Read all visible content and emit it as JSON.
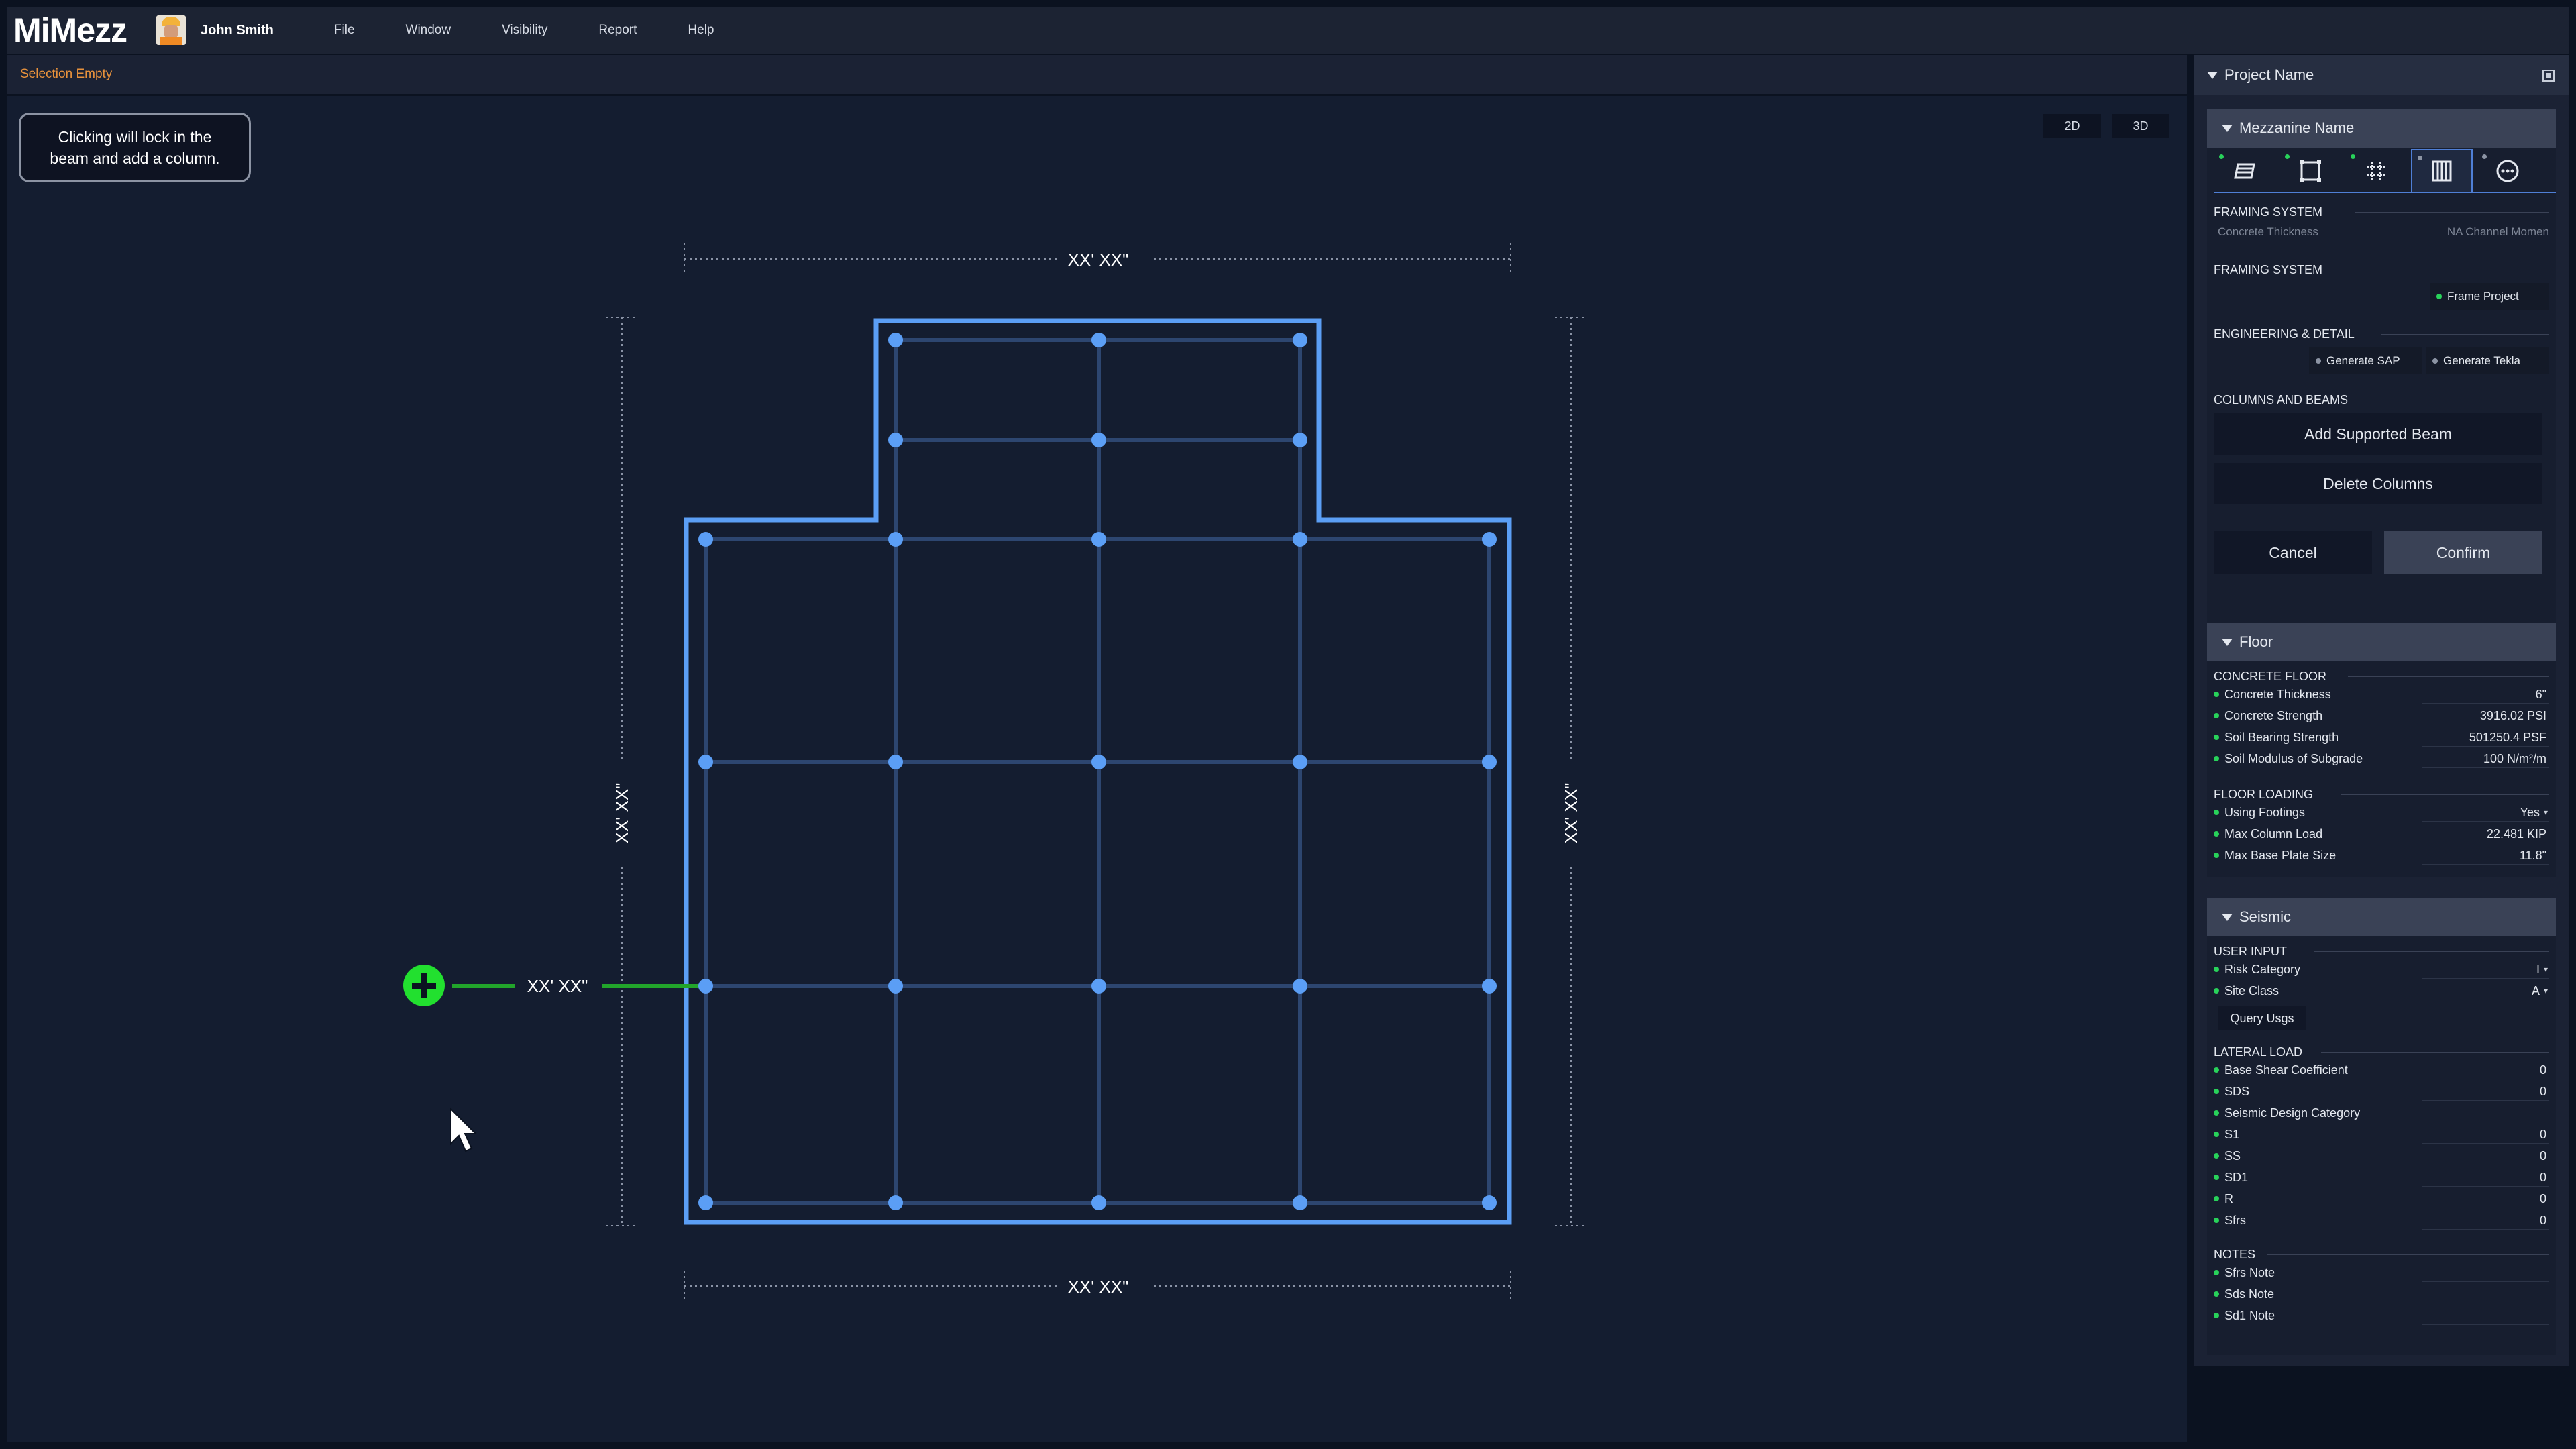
{
  "app": {
    "name": "MiMezz",
    "user": "John Smith"
  },
  "menu": [
    "File",
    "Window",
    "Visibility",
    "Report",
    "Help"
  ],
  "selection_status": "Selection Empty",
  "tooltip": {
    "line1": "Clicking will lock in the",
    "line2": "beam and add a column."
  },
  "view_buttons": {
    "two_d": "2D",
    "three_d": "3D"
  },
  "dimensions": {
    "top": "XX' XX\"",
    "bottom": "XX' XX\"",
    "left": "XX' XX\"",
    "right": "XX' XX\"",
    "column_offset": "XX' XX\""
  },
  "colors": {
    "outline": "#5b9ef5",
    "node": "#5b9ef5",
    "grid": "#2d4670",
    "add": "#22e02f",
    "status": "#e8923c"
  },
  "panel": {
    "project_name": "Project Name",
    "mezzanine": {
      "title": "Mezzanine Name",
      "tabs": [
        "deck-icon",
        "frame-icon",
        "grid-icon",
        "columns-icon",
        "more-icon"
      ],
      "framing_system_1": "FRAMING SYSTEM",
      "framing_row_label": "Concrete Thickness",
      "framing_row_value": "NA Channel Momen",
      "framing_system_2": "FRAMING SYSTEM",
      "frame_project": "Frame Project",
      "engineering": "ENGINEERING & DETAIL",
      "generate_sap": "Generate SAP",
      "generate_tekla": "Generate Tekla",
      "columns_beams": "COLUMNS AND BEAMS",
      "add_supported_beam": "Add Supported Beam",
      "delete_columns": "Delete Columns",
      "cancel": "Cancel",
      "confirm": "Confirm"
    },
    "floor": {
      "title": "Floor",
      "concrete_floor": "CONCRETE FLOOR",
      "concrete_props": [
        {
          "label": "Concrete Thickness",
          "value": "6\""
        },
        {
          "label": "Concrete Strength",
          "value": "3916.02 PSI"
        },
        {
          "label": "Soil Bearing Strength",
          "value": "501250.4 PSF"
        },
        {
          "label": "Soil Modulus of Subgrade",
          "value": "100 N/m²/m"
        }
      ],
      "floor_loading": "FLOOR LOADING",
      "loading_props": [
        {
          "label": "Using Footings",
          "value": "Yes"
        },
        {
          "label": "Max Column Load",
          "value": "22.481 KIP"
        },
        {
          "label": "Max Base Plate Size",
          "value": "11.8\""
        }
      ]
    },
    "seismic": {
      "title": "Seismic",
      "user_input": "USER INPUT",
      "input_props": [
        {
          "label": "Risk Category",
          "value": "I"
        },
        {
          "label": "Site Class",
          "value": "A"
        }
      ],
      "query_usgs": "Query Usgs",
      "lateral_load": "LATERAL LOAD",
      "lateral_props": [
        {
          "label": "Base Shear Coefficient",
          "value": "0"
        },
        {
          "label": "SDS",
          "value": "0"
        },
        {
          "label": "Seismic Design Category",
          "value": ""
        },
        {
          "label": "S1",
          "value": "0"
        },
        {
          "label": "SS",
          "value": "0"
        },
        {
          "label": "SD1",
          "value": "0"
        },
        {
          "label": "R",
          "value": "0"
        },
        {
          "label": "Sfrs",
          "value": "0"
        }
      ],
      "notes": "NOTES",
      "note_props": [
        {
          "label": "Sfrs Note",
          "value": ""
        },
        {
          "label": "Sds Note",
          "value": ""
        },
        {
          "label": "Sd1 Note",
          "value": ""
        }
      ]
    }
  }
}
